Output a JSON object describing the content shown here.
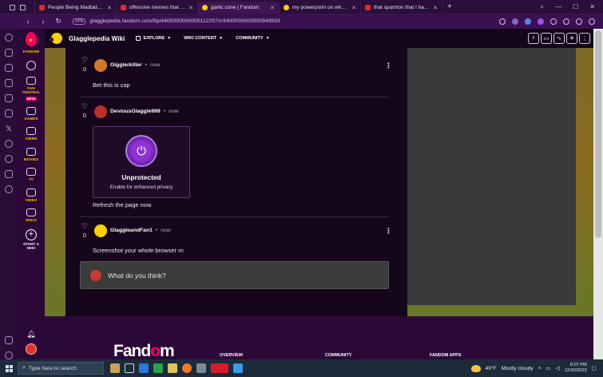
{
  "browser": {
    "tabs": [
      {
        "label": "People Being Madlads - Yo",
        "favicon_color": "#e5262d"
      },
      {
        "label": "offensive memes that if yl",
        "favicon_color": "#e5262d"
      },
      {
        "label": "garlic cone | Fandom",
        "favicon_color": "#ffd100",
        "active": true
      },
      {
        "label": "my powerpoint on why ho",
        "favicon_color": "#ffd100"
      },
      {
        "label": "that spamton that I hate -",
        "favicon_color": "#e5262d"
      }
    ],
    "new_tab": "+",
    "vpn_label": "VPN",
    "url": "glagglepedia.fandom.com/f/p/4400000000000112297/r/4400000000000943933"
  },
  "fandom_rail": {
    "brand": "FANDOM",
    "items": [
      {
        "label": "FAN\nCENTRAL",
        "badge": "BETA"
      },
      {
        "label": "GAMES"
      },
      {
        "label": "ANIME"
      },
      {
        "label": "MOVIES"
      },
      {
        "label": "TV"
      },
      {
        "label": "VIDEO"
      },
      {
        "label": "WIKIS"
      },
      {
        "label": "START A\nWIKI"
      }
    ]
  },
  "wiki_header": {
    "title": "Glagglepedia Wiki",
    "nav": [
      {
        "label": "EXPLORE"
      },
      {
        "label": "WIKI CONTENT"
      },
      {
        "label": "COMMUNITY"
      }
    ]
  },
  "comments": [
    {
      "user": "Gigglerkiller",
      "time": "now",
      "likes": "0",
      "body": "Bet this is cap",
      "avatar_color": "#d07a2a"
    },
    {
      "user": "DeviousGlaggle999",
      "time": "now",
      "likes": "0",
      "body": "Refresh the page now",
      "avatar_color": "#b8302c"
    },
    {
      "user": "GlaggleandFan1",
      "time": "now",
      "likes": "0",
      "body": "Screenshot your whole browser rn",
      "avatar_color": "#ffd100"
    }
  ],
  "privacy_card": {
    "title": "Unprotected",
    "subtitle": "Enable for enhanced privacy"
  },
  "reply": {
    "placeholder": "What do you think?"
  },
  "footer": {
    "brand_prefix": "Fand",
    "brand_o": "o",
    "brand_suffix": "m",
    "columns": [
      "OVERVIEW",
      "COMMUNITY",
      "FANDOM APPS"
    ]
  },
  "taskbar": {
    "search_placeholder": "Type here to search",
    "weather": "40°F",
    "weather_desc": "Mostly cloudy",
    "time": "8:07 PM",
    "date": "12/30/2023"
  }
}
